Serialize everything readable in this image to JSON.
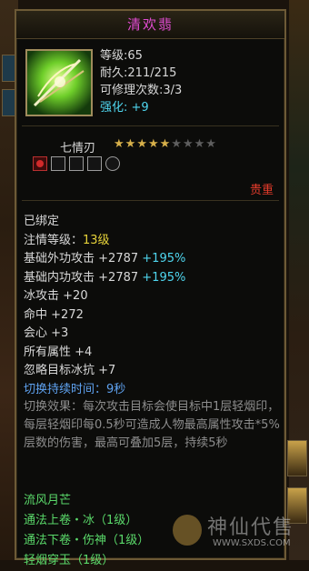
{
  "item": {
    "name": "清欢翡",
    "level_label": "等级",
    "level_value": "65",
    "durability_label": "耐久",
    "durability_value": "211/215",
    "repair_label": "可修理次数",
    "repair_value": "3/3",
    "enhance_label": "强化",
    "enhance_value": "+9"
  },
  "gem": {
    "name": "七情刃",
    "stars_total": 9,
    "stars_filled": 5
  },
  "rarity_label": "贵重",
  "bound_label": "已绑定",
  "affection": {
    "label": "注情等级：",
    "value": "13级"
  },
  "attributes": [
    {
      "label": "基础外功攻击",
      "value": "+2787",
      "bonus": "+195%"
    },
    {
      "label": "基础内功攻击",
      "value": "+2787",
      "bonus": "+195%"
    },
    {
      "label": "冰攻击",
      "value": "+20"
    },
    {
      "label": "命中",
      "value": "+272"
    },
    {
      "label": "会心",
      "value": "+3"
    },
    {
      "label": "所有属性",
      "value": "+4"
    },
    {
      "label": "忽略目标冰抗",
      "value": "+7"
    }
  ],
  "switch_duration": {
    "label": "切换持续时间：",
    "value": "9秒"
  },
  "switch_effect": {
    "label": "切换效果：",
    "text": "每次攻击目标会使目标中1层轻烟印，每层轻烟印每0.5秒可造成人物最高属性攻击*5%层数的伤害，最高可叠加5层，持续5秒"
  },
  "set_name": "流风月芒",
  "set_items": [
    "通法上卷・冰（1级）",
    "通法下卷・伤神（1级）",
    "轻烟穿玉（1级）"
  ],
  "watermark": {
    "brand": "神仙代售",
    "url": "WWW.SXDS.COM"
  },
  "colors": {
    "title": "#e04bd0",
    "cyan": "#4fd6ef",
    "green": "#5ad96a",
    "yellow": "#e6d23a",
    "blue": "#5fa2f0",
    "red": "#e33b2b",
    "star_on": "#d7b04a"
  }
}
